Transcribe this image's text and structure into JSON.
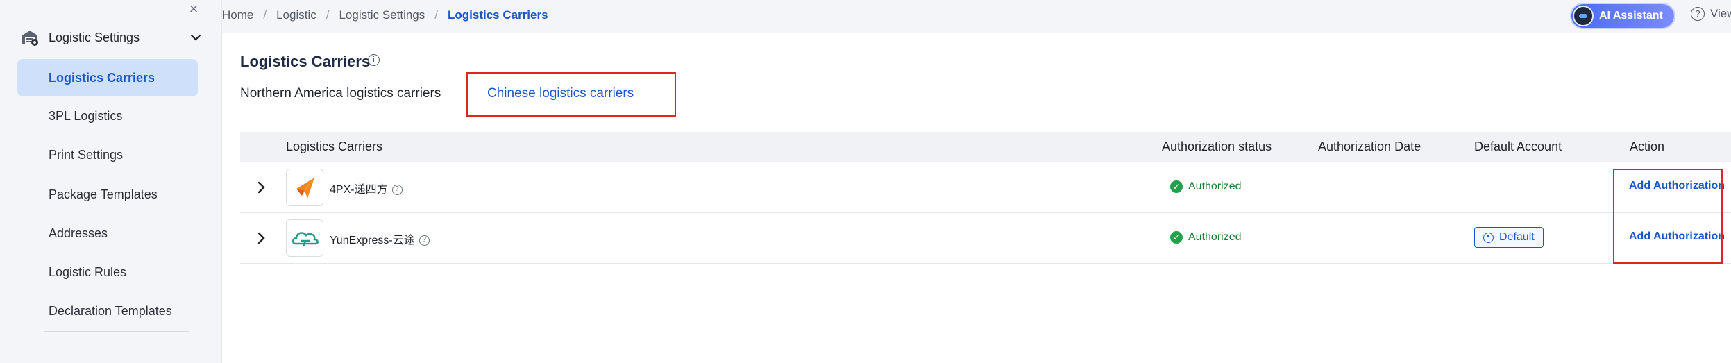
{
  "sidebar": {
    "group_label": "Logistic Settings",
    "items": [
      {
        "label": "Logistics Carriers",
        "active": true
      },
      {
        "label": "3PL Logistics",
        "active": false
      },
      {
        "label": "Print Settings",
        "active": false
      },
      {
        "label": "Package Templates",
        "active": false
      },
      {
        "label": "Addresses",
        "active": false
      },
      {
        "label": "Logistic Rules",
        "active": false
      },
      {
        "label": "Declaration Templates",
        "active": false
      }
    ],
    "close_icon": "×"
  },
  "breadcrumb": {
    "items": [
      "Home",
      "Logistic",
      "Logistic Settings"
    ],
    "current": "Logistics Carriers",
    "separator": "/"
  },
  "header": {
    "ai_button_label": "AI Assistant",
    "view_label": "View"
  },
  "page": {
    "title": "Logistics Carriers",
    "tabs": [
      {
        "label": "Northern America logistics carriers",
        "active": false
      },
      {
        "label": "Chinese logistics carriers",
        "active": true
      }
    ]
  },
  "table": {
    "columns": [
      "Logistics Carriers",
      "Authorization status",
      "Authorization Date",
      "Default Account",
      "Action"
    ],
    "rows": [
      {
        "carrier": "4PX-递四方",
        "status": "Authorized",
        "date": "",
        "default_account": "",
        "action": "Add Authorization"
      },
      {
        "carrier": "YunExpress-云途",
        "status": "Authorized",
        "date": "",
        "default_account": "Default",
        "action": "Add Authorization"
      }
    ]
  },
  "colors": {
    "accent": "#1a57c6",
    "success": "#22a04b",
    "highlight": "#e02424",
    "sidebar_active_bg": "#cfe0fb"
  },
  "icons": [
    "close-icon",
    "warehouse-settings-icon",
    "chevron-down-icon",
    "info-icon",
    "chevron-right-icon",
    "help-icon",
    "check-circle-icon",
    "user-circle-icon"
  ]
}
